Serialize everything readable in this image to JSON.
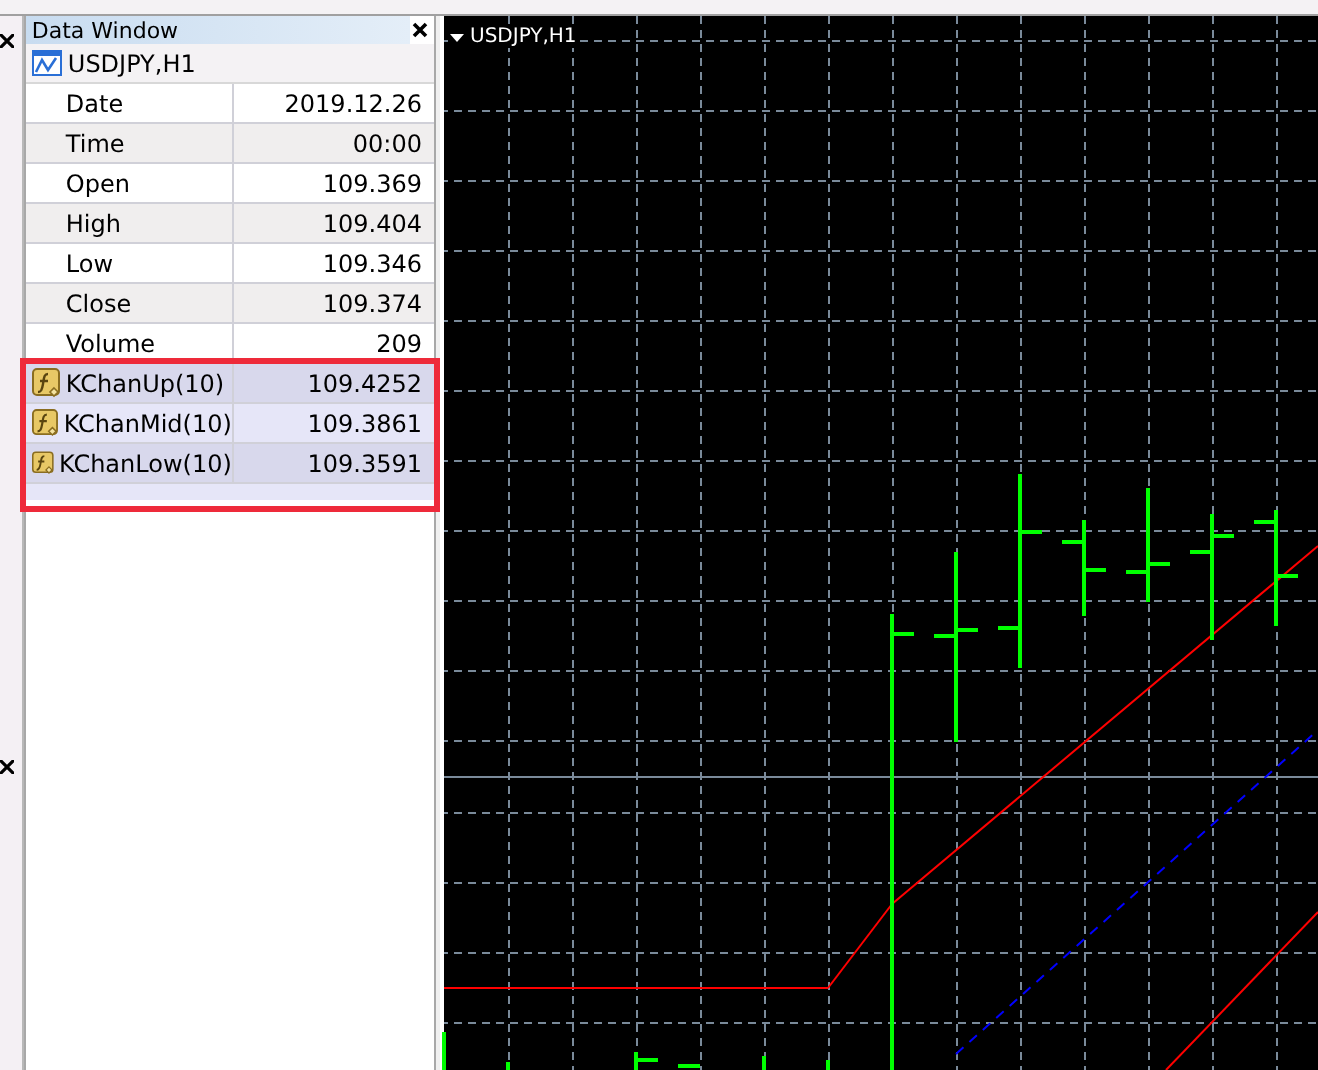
{
  "data_window": {
    "title": "Data Window",
    "symbol": "USDJPY,H1",
    "highlighted": true,
    "rows": [
      {
        "name": "Date",
        "value": "2019.12.26",
        "kind": "field"
      },
      {
        "name": "Time",
        "value": "00:00",
        "kind": "field"
      },
      {
        "name": "Open",
        "value": "109.369",
        "kind": "field"
      },
      {
        "name": "High",
        "value": "109.404",
        "kind": "field"
      },
      {
        "name": "Low",
        "value": "109.346",
        "kind": "field"
      },
      {
        "name": "Close",
        "value": "109.374",
        "kind": "field"
      },
      {
        "name": "Volume",
        "value": "209",
        "kind": "field"
      },
      {
        "name": "KChanUp(10)",
        "value": "109.4252",
        "kind": "indicator"
      },
      {
        "name": "KChanMid(10)",
        "value": "109.3861",
        "kind": "indicator"
      },
      {
        "name": "KChanLow(10)",
        "value": "109.3591",
        "kind": "indicator"
      }
    ]
  },
  "chart": {
    "title": "USDJPY,H1"
  }
}
